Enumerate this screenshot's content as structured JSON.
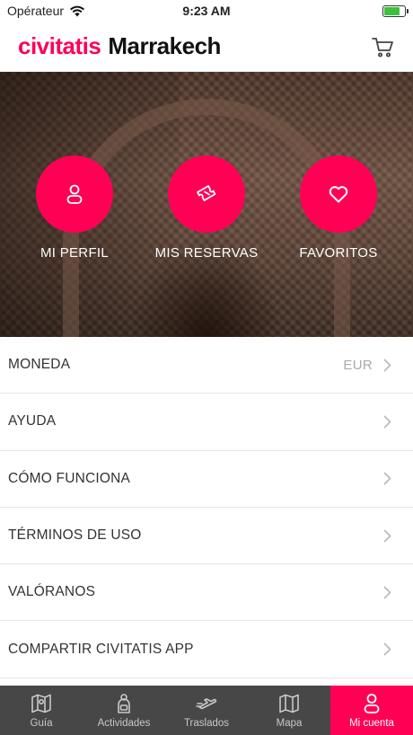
{
  "status_bar": {
    "carrier": "Opérateur",
    "time": "9:23 AM",
    "battery_level": 0.75
  },
  "header": {
    "brand": "civitatis",
    "city": "Marrakech",
    "cart_icon": "cart-icon"
  },
  "hero": {
    "actions": [
      {
        "label": "MI PERFIL",
        "icon": "user-icon"
      },
      {
        "label": "MIS RESERVAS",
        "icon": "ticket-icon"
      },
      {
        "label": "FAVORITOS",
        "icon": "heart-icon"
      }
    ]
  },
  "menu": {
    "items": [
      {
        "label": "MONEDA",
        "value": "EUR"
      },
      {
        "label": "AYUDA",
        "value": ""
      },
      {
        "label": "CÓMO FUNCIONA",
        "value": ""
      },
      {
        "label": "TÉRMINOS DE USO",
        "value": ""
      },
      {
        "label": "VALÓRANOS",
        "value": ""
      },
      {
        "label": "COMPARTIR CIVITATIS APP",
        "value": ""
      }
    ]
  },
  "tab_bar": {
    "tabs": [
      {
        "label": "Guía",
        "icon": "map-guide-icon",
        "active": false
      },
      {
        "label": "Actividades",
        "icon": "activities-icon",
        "active": false
      },
      {
        "label": "Traslados",
        "icon": "transfer-icon",
        "active": false
      },
      {
        "label": "Mapa",
        "icon": "map-icon",
        "active": false
      },
      {
        "label": "Mi cuenta",
        "icon": "account-icon",
        "active": true
      }
    ]
  },
  "colors": {
    "brand": "#ff0055",
    "tab_bar_bg": "#474747"
  }
}
